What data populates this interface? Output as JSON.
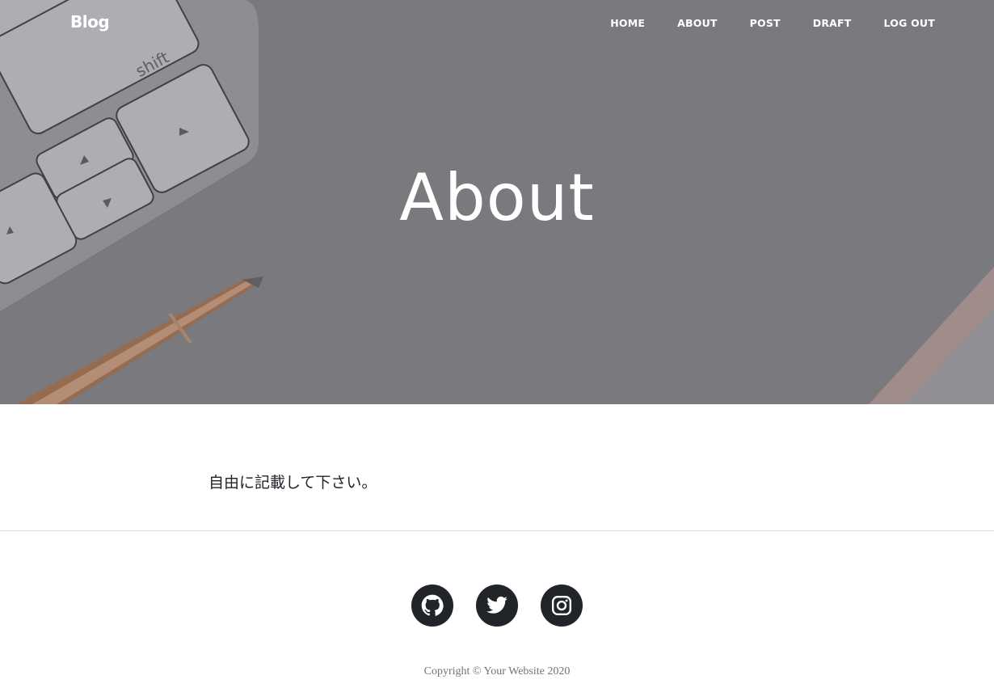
{
  "navbar": {
    "brand": "Blog",
    "items": [
      {
        "label": "HOME"
      },
      {
        "label": "ABOUT"
      },
      {
        "label": "POST"
      },
      {
        "label": "DRAFT"
      },
      {
        "label": "LOG OUT"
      }
    ]
  },
  "header": {
    "title": "About",
    "image_key_label": "shift"
  },
  "main": {
    "body_text": "自由に記載して下さい。"
  },
  "footer": {
    "social": [
      {
        "icon": "github-icon"
      },
      {
        "icon": "twitter-icon"
      },
      {
        "icon": "instagram-icon"
      }
    ],
    "copyright": "Copyright © Your Website 2020"
  },
  "colors": {
    "masthead_gray": "#8b8b8f",
    "social_circle": "#212529",
    "copyright_text": "#6c757d"
  }
}
